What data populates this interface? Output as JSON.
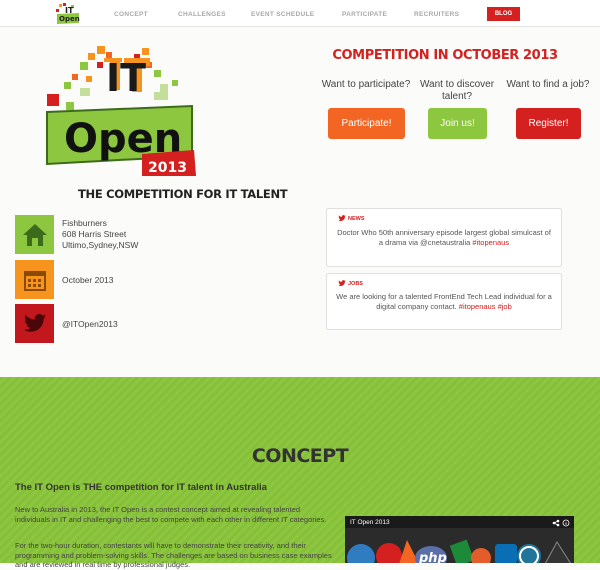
{
  "nav": {
    "items": [
      {
        "label": "CONCEPT"
      },
      {
        "label": "CHALLENGES"
      },
      {
        "label": "EVENT SCHEDULE"
      },
      {
        "label": "PARTICIPATE"
      },
      {
        "label": "RECRUITERS"
      }
    ],
    "blog_label": "BLOG"
  },
  "logo": {
    "text_it": "IT",
    "text_open": "Open",
    "year": "2013"
  },
  "hero": {
    "tagline": "THE COMPETITION FOR IT TALENT",
    "competition_title": "COMPETITION IN OCTOBER 2013",
    "ctas": [
      {
        "question": "Want to participate?",
        "button": "Participate!",
        "color": "#f26522"
      },
      {
        "question": "Want to discover talent?",
        "button": "Join us!",
        "color": "#8dc63f"
      },
      {
        "question": "Want to find a job?",
        "button": "Register!",
        "color": "#d4201f"
      }
    ]
  },
  "info": {
    "venue": {
      "line1": "Fishburners",
      "line2": "608 Harris Street",
      "line3": "Ultimo,Sydney,NSW"
    },
    "date": "October 2013",
    "twitter": "@ITOpen2013"
  },
  "cards": {
    "news": {
      "label": "NEWS",
      "text": "Doctor Who 50th anniversary episode largest global simulcast of a drama via @cnetaustralia",
      "tag": "#itopenaus"
    },
    "jobs": {
      "label": "JOBS",
      "text": "We are looking for a talented FrontEnd Tech Lead individual for a digital company contact.",
      "tag1": "#itopenaus",
      "tag2": "#job"
    }
  },
  "concept": {
    "title": "CONCEPT",
    "heading": "The IT Open is THE competition for IT talent in Australia",
    "p1": "New to Australia in 2013, the IT Open is a contest concept aimed at revealing talented individuals in IT and challenging the best to compete with each other in different IT categories.",
    "p2": "For the two-hour duration, contestants will have to demonstrate their creativity, and their programming and problem-solving skills. The challenges are based on business case examples and are reviewed in real time by professional judges.",
    "video_title": "IT Open 2013"
  },
  "colors": {
    "red": "#d4201f",
    "green": "#8dc63f",
    "orange": "#f26522"
  }
}
